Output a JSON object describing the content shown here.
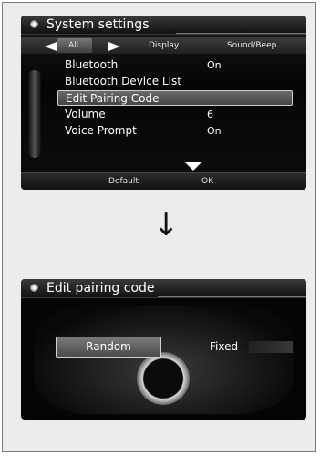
{
  "screen1": {
    "title": "System settings",
    "tabs": [
      {
        "label": "All",
        "active": true
      },
      {
        "label": "Display",
        "active": false
      },
      {
        "label": "Sound/Beep",
        "active": false
      }
    ],
    "menu_items": [
      {
        "label": "Bluetooth",
        "value": "On",
        "selected": false
      },
      {
        "label": "Bluetooth Device List",
        "value": "",
        "selected": false
      },
      {
        "label": "Edit Pairing Code",
        "value": "",
        "selected": true
      },
      {
        "label": "Volume",
        "value": "6",
        "selected": false
      },
      {
        "label": "Voice Prompt",
        "value": "On",
        "selected": false
      }
    ],
    "bottom_left": "Default",
    "bottom_right": "OK"
  },
  "connector_glyph": "↓",
  "screen2": {
    "title": "Edit pairing code",
    "options": [
      {
        "label": "Random",
        "selected": true
      },
      {
        "label": "Fixed",
        "selected": false
      }
    ]
  },
  "colors": {
    "screen_bg": "#050505",
    "text": "#ffffff",
    "frame_bg": "#ececec"
  }
}
